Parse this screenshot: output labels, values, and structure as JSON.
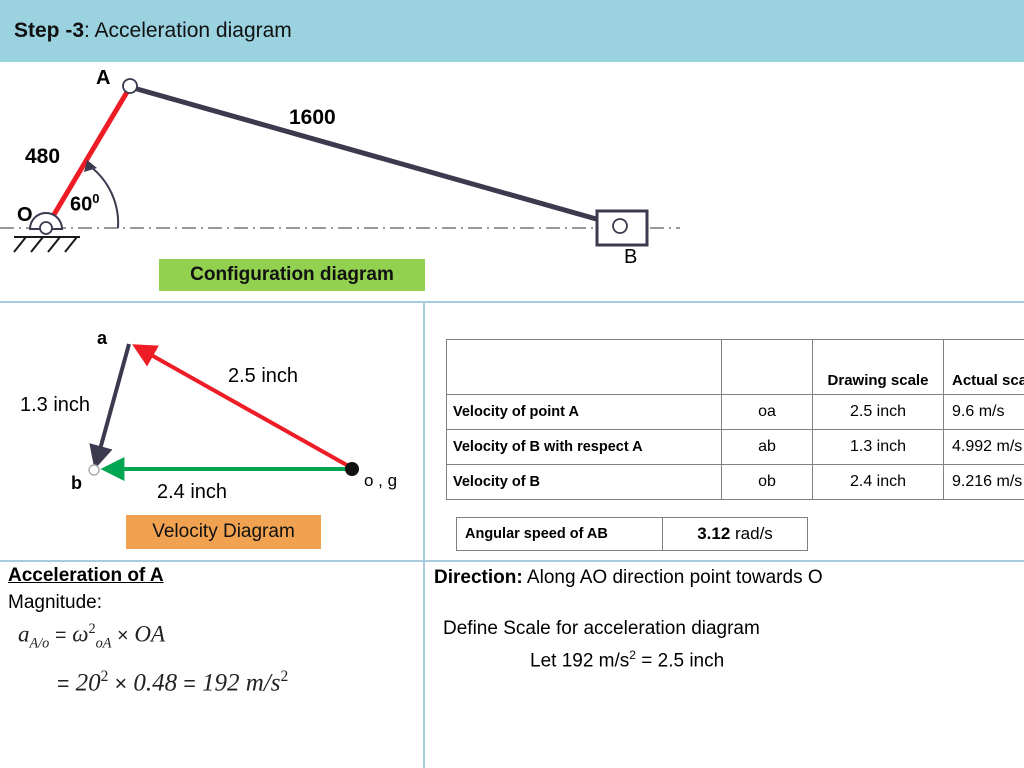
{
  "header": {
    "step_label": "Step -3",
    "title_rest": ": Acceleration diagram"
  },
  "configuration_diagram": {
    "caption": "Configuration diagram",
    "caption_color": "#92D050",
    "point_a_label": "A",
    "point_o_label": "O",
    "point_b_label": "B",
    "crank_length_label": "480",
    "crank_color": "#EE1C25",
    "rod_length_label": "1600",
    "rod_color": "#3B3A4F",
    "angle_label": "60",
    "angle_superscript": "0"
  },
  "velocity_diagram": {
    "caption": "Velocity Diagram",
    "caption_color": "#F0A250",
    "vertex_a_label": "a",
    "vertex_b_label": "b",
    "vertex_og_label": "o , g",
    "oa_label": "2.5 inch",
    "ab_label": "1.3 inch",
    "ob_label": "2.4  inch",
    "oa_color": "#EE1C25",
    "ab_color": "#3B3A4F",
    "ob_color": "#00A651"
  },
  "velocity_table": {
    "headers": [
      "",
      "",
      "Drawing scale",
      "Actual scale"
    ],
    "rows": [
      {
        "description": "Velocity of point A",
        "symbol": "oa",
        "drawing_scale": "2.5 inch",
        "actual_scale": "9.6 m/s"
      },
      {
        "description": "Velocity of B with respect A",
        "symbol": "ab",
        "drawing_scale": "1.3 inch",
        "actual_scale": "4.992 m/s"
      },
      {
        "description": "Velocity of B",
        "symbol": "ob",
        "drawing_scale": "2.4 inch",
        "actual_scale": "9.216 m/s"
      }
    ]
  },
  "angular_speed": {
    "label": "Angular speed of  AB",
    "value": "3.12",
    "unit": "rad/s"
  },
  "acceleration": {
    "heading": "Acceleration of A",
    "magnitude_label": "Magnitude:",
    "formula_symbol": "a",
    "formula_symbol_sub": "A/o",
    "formula_equals": "=",
    "formula_omega": "ω",
    "formula_omega_sup": "2",
    "formula_omega_sub": "oA",
    "formula_times": "×",
    "formula_oa": "OA",
    "result_equals": "=",
    "result_base": "20",
    "result_exp": "2",
    "result_times": "×",
    "result_factor": "0.48",
    "result_equals2": "=",
    "result_value": "192",
    "result_unit": "m/s",
    "result_unit_exp": "2"
  },
  "direction": {
    "label": "Direction:",
    "text": "Along AO direction point towards O",
    "define_scale": "Define Scale for acceleration diagram",
    "let_prefix": "Let 192 m/s",
    "let_exp": "2",
    "let_suffix": " = 2.5 inch"
  }
}
